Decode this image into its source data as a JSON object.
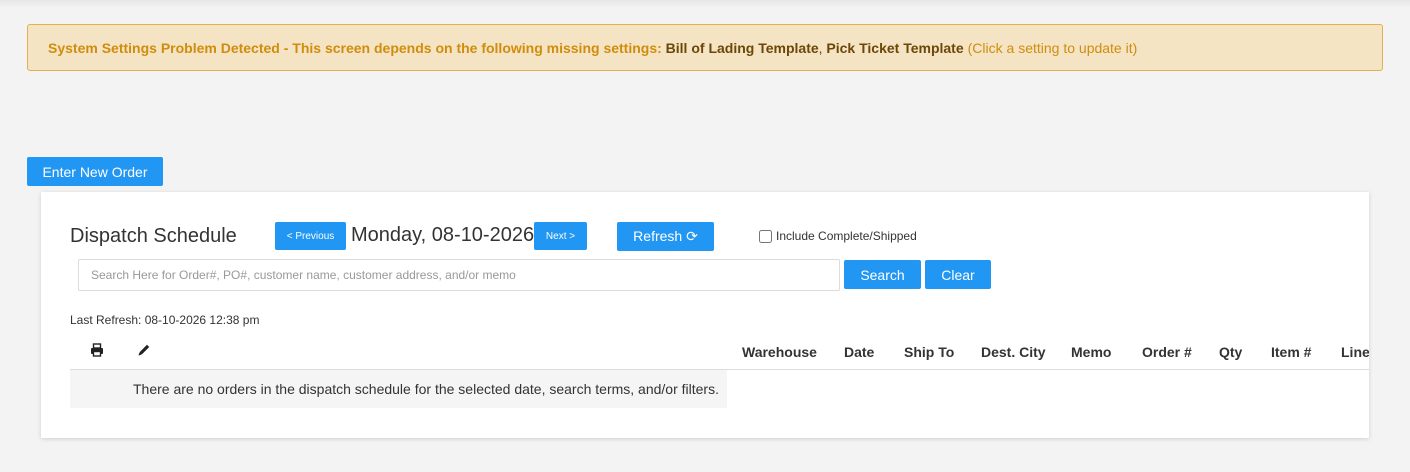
{
  "alert": {
    "lead": "System Settings Problem Detected - This screen depends on the following missing settings:",
    "settings": [
      "Bill of Lading Template",
      "Pick Ticket Template"
    ],
    "separator": ",",
    "hint": "(Click a setting to update it)",
    "color": "#d08d0d",
    "background": "#f5e4c4"
  },
  "enter_button": "Enter New Order",
  "schedule": {
    "title": "Dispatch Schedule",
    "prev_label": "< Previous",
    "date": "Monday, 08-10-2026",
    "next_label": "Next >",
    "refresh_label": "Refresh ⟳",
    "include_label": "Include Complete/Shipped",
    "include_checked": false,
    "search_placeholder": "Search Here for Order#, PO#, customer name, customer address, and/or memo",
    "search_value": "",
    "search_label": "Search",
    "clear_label": "Clear",
    "last_refresh": "Last Refresh: 08-10-2026 12:38 pm"
  },
  "table": {
    "icon_columns": [
      "print-icon",
      "pencil-icon"
    ],
    "columns": [
      "Warehouse",
      "Date",
      "Ship To",
      "Dest. City",
      "Memo",
      "Order #",
      "Qty",
      "Item #",
      "Line"
    ],
    "empty_message": "There are no orders in the dispatch schedule for the selected date, search terms, and/or filters."
  },
  "accent_color": "#2196f3"
}
